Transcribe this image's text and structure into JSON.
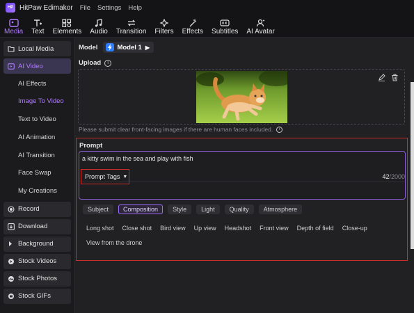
{
  "app": {
    "title": "HitPaw Edimakor",
    "logo_text": "HP"
  },
  "menu": [
    "File",
    "Settings",
    "Help"
  ],
  "toolbar": [
    {
      "label": "Media",
      "icon": "media-icon",
      "active": true
    },
    {
      "label": "Text",
      "icon": "text-icon"
    },
    {
      "label": "Elements",
      "icon": "elements-icon"
    },
    {
      "label": "Audio",
      "icon": "audio-icon"
    },
    {
      "label": "Transition",
      "icon": "transition-icon"
    },
    {
      "label": "Filters",
      "icon": "filters-icon"
    },
    {
      "label": "Effects",
      "icon": "effects-icon"
    },
    {
      "label": "Subtitles",
      "icon": "subtitles-icon"
    },
    {
      "label": "AI Avatar",
      "icon": "ai-avatar-icon"
    }
  ],
  "sidebar": {
    "local_media": "Local Media",
    "ai_video": "AI Video",
    "sub": [
      "AI Effects",
      "Image To Video",
      "Text to Video",
      "AI Animation",
      "AI Transition",
      "Face Swap",
      "My Creations"
    ],
    "active_sub": "Image To Video",
    "record": "Record",
    "download": "Download",
    "background": "Background",
    "stock_videos": "Stock Videos",
    "stock_photos": "Stock Photos",
    "stock_gifs": "Stock GIFs"
  },
  "main": {
    "model_label": "Model",
    "model_value": "Model 1",
    "upload_label": "Upload",
    "upload_note": "Please submit clear front-facing images if there are human faces included.",
    "prompt_label": "Prompt",
    "prompt_text": "a kitty swim in the sea and play with fish",
    "prompt_tags_label": "Prompt Tags",
    "char_count": "42",
    "char_max": "/2000",
    "categories": [
      "Subject",
      "Composition",
      "Style",
      "Light",
      "Quality",
      "Atmosphere"
    ],
    "active_category": "Composition",
    "tags": [
      "Long shot",
      "Close shot",
      "Bird view",
      "Up view",
      "Headshot",
      "Front view",
      "Depth of field",
      "Close-up",
      "View from the drone"
    ]
  },
  "colors": {
    "accent": "#b07cff",
    "highlight": "#d22a2a",
    "model_badge": "#2d7dff"
  }
}
